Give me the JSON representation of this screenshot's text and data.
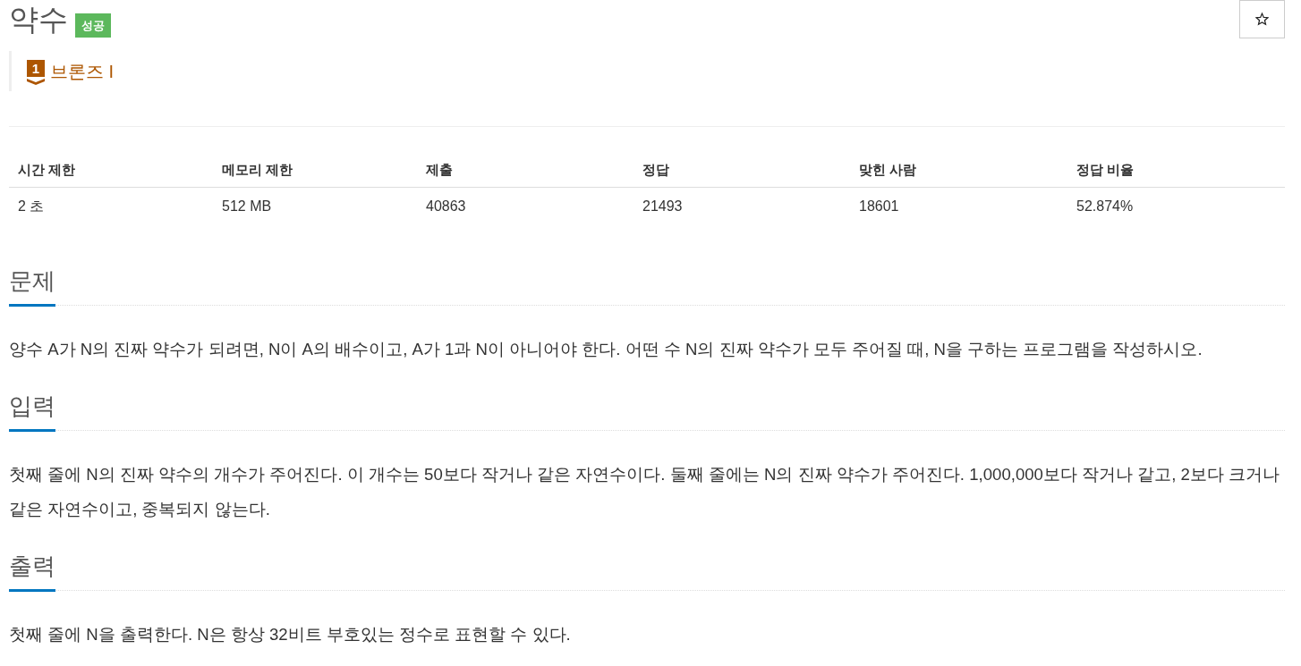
{
  "header": {
    "title": "약수",
    "result": "성공"
  },
  "tier": {
    "level": "1",
    "name": "브론즈 I"
  },
  "limits_table": {
    "columns": [
      "시간 제한",
      "메모리 제한",
      "제출",
      "정답",
      "맞힌 사람",
      "정답 비율"
    ],
    "rows": [
      [
        "2 초",
        "512 MB",
        "40863",
        "21493",
        "18601",
        "52.874%"
      ]
    ]
  },
  "sections": [
    {
      "heading": "문제",
      "text": "양수 A가 N의 진짜 약수가 되려면, N이 A의 배수이고, A가 1과 N이 아니어야 한다. 어떤 수 N의 진짜 약수가 모두 주어질 때, N을 구하는 프로그램을 작성하시오."
    },
    {
      "heading": "입력",
      "text": "첫째 줄에 N의 진짜 약수의 개수가 주어진다. 이 개수는 50보다 작거나 같은 자연수이다. 둘째 줄에는 N의 진짜 약수가 주어진다. 1,000,000보다 작거나 같고, 2보다 크거나 같은 자연수이고, 중복되지 않는다."
    },
    {
      "heading": "출력",
      "text": "첫째 줄에 N을 출력한다. N은 항상 32비트 부호있는 정수로 표현할 수 있다."
    }
  ]
}
